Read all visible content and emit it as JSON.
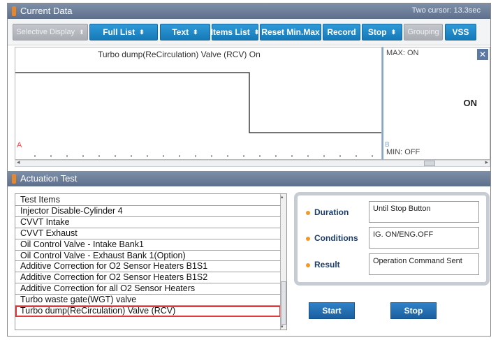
{
  "current_data": {
    "title": "Current Data",
    "cursor_text": "Two cursor: 13.3sec"
  },
  "toolbar": {
    "selective_display": "Selective Display",
    "full_list": "Full List",
    "text": "Text",
    "items_list": "Items List",
    "reset_min_max": "Reset Min.Max",
    "record": "Record",
    "stop": "Stop",
    "grouping": "Grouping",
    "vss": "VSS",
    "spin_glyph": "⬍"
  },
  "graph": {
    "title": "Turbo dump(ReCirculation) Valve (RCV) On",
    "cursor_a": "A",
    "cursor_b": "B",
    "max_label": "MAX: ON",
    "min_label": "MIN: OFF",
    "current_value": "ON",
    "close_glyph": "✕"
  },
  "chart_data": {
    "type": "line",
    "title": "Turbo dump(ReCirculation) Valve (RCV) On",
    "series": [
      {
        "values": [
          "ON",
          "ON",
          "OFF",
          "OFF"
        ]
      }
    ],
    "step_change_fraction": 0.64
  },
  "actuation": {
    "title": "Actuation Test",
    "header": "Test Items",
    "items": [
      "Injector Disable-Cylinder 4",
      "CVVT Intake",
      "CVVT Exhaust",
      "Oil Control Valve - Intake Bank1",
      "Oil Control Valve - Exhaust Bank 1(Option)",
      "Additive Correction for O2 Sensor Heaters B1S1",
      "Additive Correction for O2 Sensor Heaters B1S2",
      "Additive Correction for all O2 Sensor Heaters",
      "Turbo waste gate(WGT) valve",
      "Turbo dump(ReCirculation) Valve (RCV)"
    ],
    "selected_index": 9,
    "duration_label": "Duration",
    "duration_value": "Until Stop Button",
    "conditions_label": "Conditions",
    "conditions_value": "IG. ON/ENG.OFF",
    "result_label": "Result",
    "result_value": "Operation Command Sent",
    "start_label": "Start",
    "stop_label": "Stop"
  },
  "colors": {
    "header": "#5d6f8c",
    "button": "#1679b8",
    "selected_outline": "#e03a3a",
    "bullet": "#f09a2a"
  }
}
